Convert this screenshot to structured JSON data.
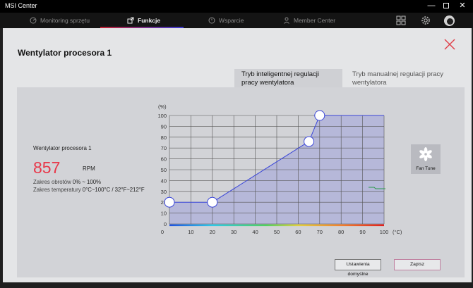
{
  "window": {
    "title": "MSI Center",
    "min": "—",
    "close": "✕"
  },
  "nav": {
    "tabs": [
      {
        "label": "Monitoring sprzętu",
        "icon": "gauge-icon"
      },
      {
        "label": "Funkcje",
        "icon": "export-icon",
        "active": true
      },
      {
        "label": "Wsparcie",
        "icon": "clock-icon"
      },
      {
        "label": "Member Center",
        "icon": "person-icon"
      }
    ],
    "accent": [
      "#c02030",
      "#3a3ad0"
    ]
  },
  "dialog": {
    "title": "Wentylator procesora 1",
    "modes": {
      "smart": "Tryb inteligentnej regulacji pracy wentylatora",
      "manual": "Tryb manualnej regulacji pracy wentylatora"
    },
    "fan": {
      "name": "Wentylator procesora 1",
      "rpm": "857",
      "rpm_unit": "RPM",
      "speed_range_label": "Zakres obrotów",
      "speed_range": "0% ~ 100%",
      "temp_range_label": "Zakres temperatury",
      "temp_range": "0°C~100°C / 32°F~212°F"
    },
    "fan_tune_label": "Fan Tune",
    "buttons": {
      "default": "Ustawienia domyślne",
      "save": "Zapisz"
    },
    "close_color": "#e0404a",
    "rpm_color": "#e8384a"
  },
  "chart_data": {
    "type": "line",
    "ylabel": "(%)",
    "xlabel": "(°C)",
    "xlim": [
      0,
      100
    ],
    "ylim": [
      0,
      100
    ],
    "x_ticks": [
      0,
      10,
      20,
      30,
      40,
      50,
      60,
      70,
      80,
      90,
      100
    ],
    "y_ticks": [
      0,
      10,
      20,
      30,
      40,
      50,
      60,
      70,
      80,
      90,
      100
    ],
    "series": [
      {
        "x": [
          0,
          20,
          65,
          70,
          100
        ],
        "y": [
          20,
          20,
          76,
          100,
          100
        ]
      }
    ],
    "control_points": [
      [
        0,
        20
      ],
      [
        20,
        20
      ],
      [
        65,
        76
      ],
      [
        70,
        100
      ]
    ],
    "line_color": "#3a46d8",
    "fill_color": "#9ea3da"
  }
}
